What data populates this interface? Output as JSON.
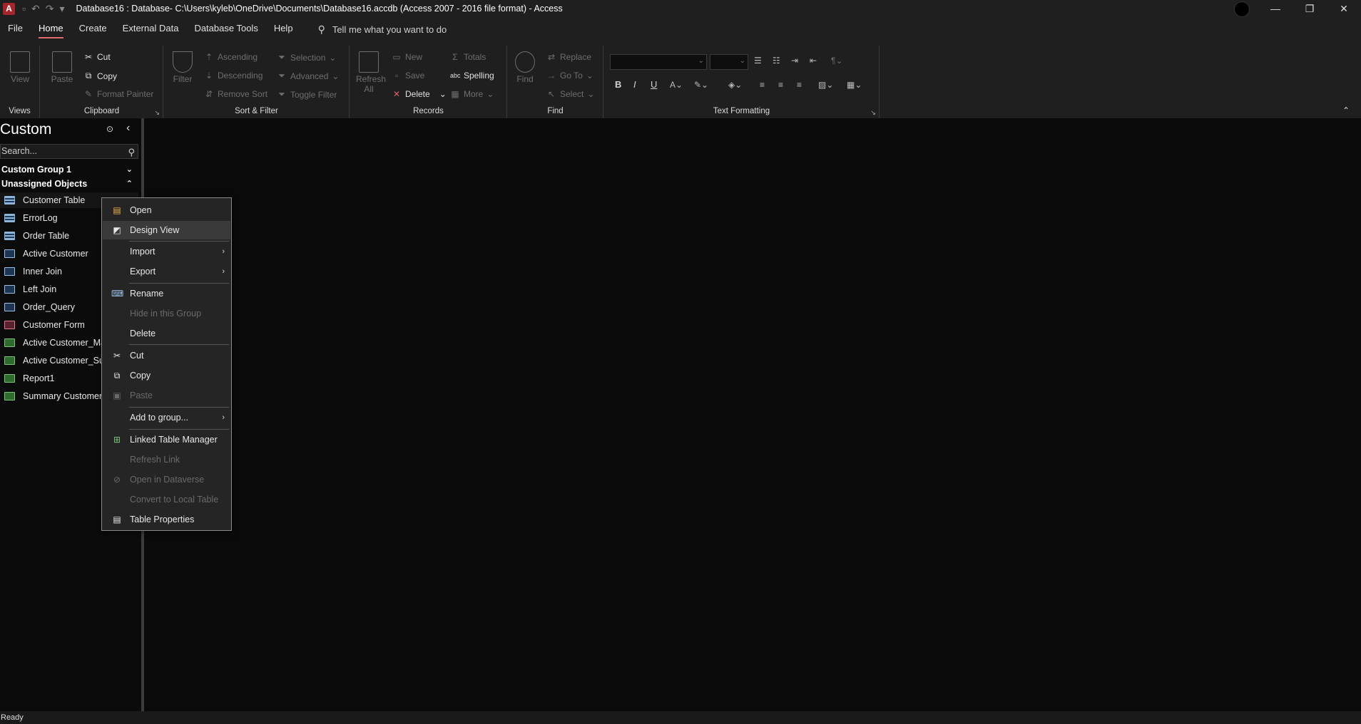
{
  "window": {
    "title": "Database16 : Database- C:\\Users\\kyleb\\OneDrive\\Documents\\Database16.accdb (Access 2007 - 2016 file format)  -  Access",
    "app_logo": "A",
    "minimize": "—",
    "restore": "❐",
    "close": "✕"
  },
  "menu": {
    "tabs": [
      "File",
      "Home",
      "Create",
      "External Data",
      "Database Tools",
      "Help"
    ],
    "active_tab": "Home",
    "tell_me": "Tell me what you want to do"
  },
  "ribbon": {
    "views": {
      "label": "Views",
      "view": "View"
    },
    "clipboard": {
      "label": "Clipboard",
      "paste": "Paste",
      "cut": "Cut",
      "copy": "Copy",
      "format_painter": "Format Painter"
    },
    "sort_filter": {
      "label": "Sort & Filter",
      "filter": "Filter",
      "ascending": "Ascending",
      "descending": "Descending",
      "remove_sort": "Remove Sort",
      "selection": "Selection",
      "advanced": "Advanced",
      "toggle_filter": "Toggle Filter"
    },
    "records": {
      "label": "Records",
      "refresh": "Refresh",
      "refresh_all": "All",
      "new": "New",
      "save": "Save",
      "delete": "Delete",
      "totals": "Totals",
      "spelling": "Spelling",
      "more": "More"
    },
    "find": {
      "label": "Find",
      "find": "Find",
      "replace": "Replace",
      "go_to": "Go To",
      "select": "Select"
    },
    "text_formatting": {
      "label": "Text Formatting",
      "bold": "B",
      "italic": "I",
      "underline": "U"
    }
  },
  "nav": {
    "title": "Custom",
    "search_placeholder": "Search...",
    "groups": [
      {
        "name": "Custom Group 1",
        "chevron": "⌄"
      },
      {
        "name": "Unassigned Objects",
        "chevron": "⌃"
      }
    ],
    "items": [
      {
        "label": "Customer Table",
        "type": "table"
      },
      {
        "label": "ErrorLog",
        "type": "table"
      },
      {
        "label": "Order Table",
        "type": "table"
      },
      {
        "label": "Active Customer",
        "type": "query"
      },
      {
        "label": "Inner Join",
        "type": "query"
      },
      {
        "label": "Left Join",
        "type": "query"
      },
      {
        "label": "Order_Query",
        "type": "query"
      },
      {
        "label": "Customer Form",
        "type": "form"
      },
      {
        "label": "Active Customer_Ma",
        "type": "report"
      },
      {
        "label": "Active Customer_Sub",
        "type": "report"
      },
      {
        "label": "Report1",
        "type": "report"
      },
      {
        "label": "Summary Customer",
        "type": "report"
      }
    ]
  },
  "context_menu": {
    "items": [
      {
        "label": "Open",
        "icon": "open-icon",
        "enabled": true
      },
      {
        "label": "Design View",
        "icon": "design-view-icon",
        "enabled": true,
        "highlighted": true
      },
      {
        "label": "Import",
        "submenu": true,
        "enabled": true
      },
      {
        "label": "Export",
        "submenu": true,
        "enabled": true
      },
      {
        "label": "Rename",
        "icon": "rename-icon",
        "enabled": true
      },
      {
        "label": "Hide in this Group",
        "enabled": false
      },
      {
        "label": "Delete",
        "enabled": true
      },
      {
        "label": "Cut",
        "icon": "cut-icon",
        "enabled": true
      },
      {
        "label": "Copy",
        "icon": "copy-icon",
        "enabled": true
      },
      {
        "label": "Paste",
        "icon": "paste-icon",
        "enabled": false
      },
      {
        "label": "Add to group...",
        "submenu": true,
        "enabled": true
      },
      {
        "label": "Linked Table Manager",
        "icon": "linked-table-icon",
        "enabled": true
      },
      {
        "label": "Refresh Link",
        "enabled": false
      },
      {
        "label": "Open in Dataverse",
        "icon": "dataverse-icon",
        "enabled": false
      },
      {
        "label": "Convert to Local Table",
        "enabled": false
      },
      {
        "label": "Table Properties",
        "icon": "properties-icon",
        "enabled": true
      }
    ]
  },
  "status": {
    "text": "Ready"
  }
}
